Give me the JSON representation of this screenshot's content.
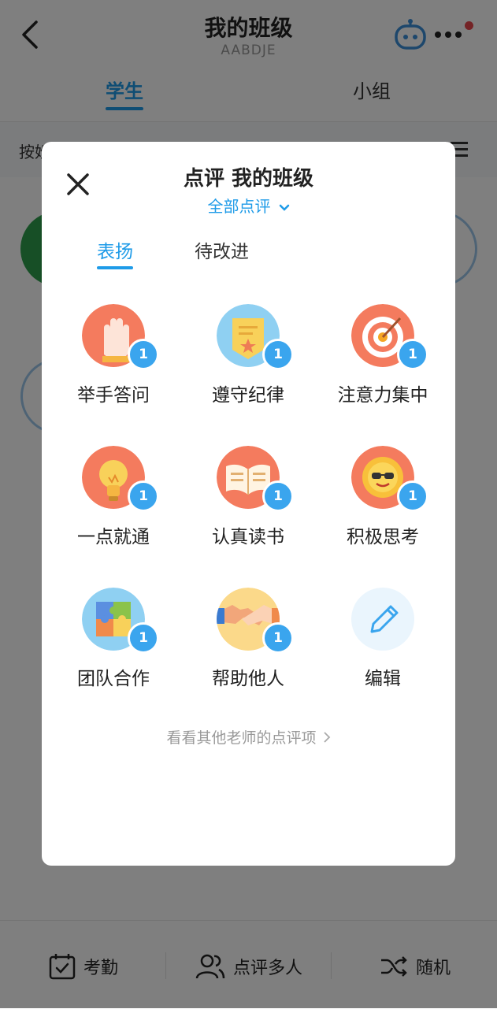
{
  "header": {
    "title": "我的班级",
    "class_code": "AABDJE"
  },
  "tabs": {
    "students": "学生",
    "groups": "小组"
  },
  "sortbar": {
    "label": "按姓"
  },
  "bottom_bar": {
    "attendance": "考勤",
    "multi_review": "点评多人",
    "random": "随机"
  },
  "modal": {
    "title": "点评 我的班级",
    "scope": "全部点评",
    "tabs": {
      "praise": "表扬",
      "improve": "待改进"
    },
    "items": [
      {
        "label": "举手答问",
        "count": "1",
        "icon": "raised-hand-icon"
      },
      {
        "label": "遵守纪律",
        "count": "1",
        "icon": "certificate-icon"
      },
      {
        "label": "注意力集中",
        "count": "1",
        "icon": "target-icon"
      },
      {
        "label": "一点就通",
        "count": "1",
        "icon": "lightbulb-icon"
      },
      {
        "label": "认真读书",
        "count": "1",
        "icon": "open-book-icon"
      },
      {
        "label": "积极思考",
        "count": "1",
        "icon": "sun-sunglasses-icon"
      },
      {
        "label": "团队合作",
        "count": "1",
        "icon": "puzzle-icon"
      },
      {
        "label": "帮助他人",
        "count": "1",
        "icon": "handshake-icon"
      },
      {
        "label": "编辑",
        "icon": "pencil-icon"
      }
    ],
    "others_link": "看看其他老师的点评项"
  },
  "colors": {
    "accent": "#1e9be8",
    "badge": "#3aa5ee",
    "notification_dot": "#e8474c"
  }
}
